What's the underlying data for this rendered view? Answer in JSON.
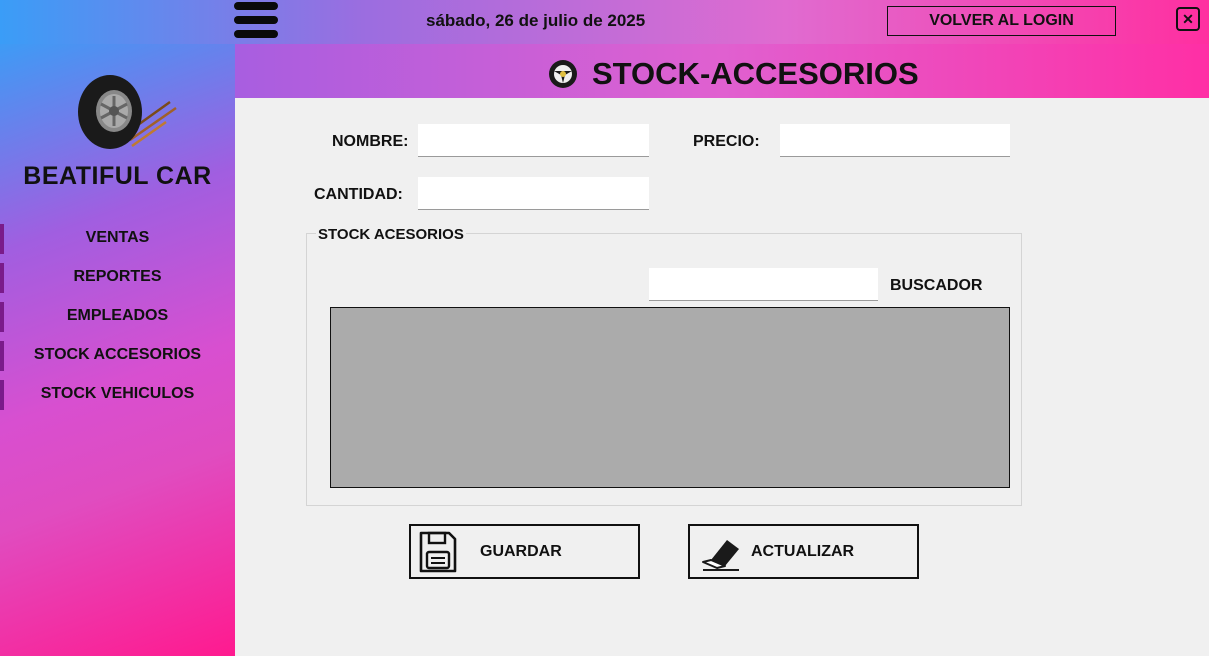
{
  "topbar": {
    "date": "sábado, 26 de julio de 2025",
    "login_button": "VOLVER AL LOGIN",
    "close_icon": "close-icon"
  },
  "sidebar": {
    "brand": "BEATIFUL CAR",
    "logo_icon": "tire-icon",
    "items": [
      {
        "label": "VENTAS"
      },
      {
        "label": "REPORTES"
      },
      {
        "label": "EMPLEADOS"
      },
      {
        "label": "STOCK ACCESORIOS"
      },
      {
        "label": "STOCK VEHICULOS"
      }
    ]
  },
  "header": {
    "title": "STOCK-ACCESORIOS",
    "icon": "steering-wheel-icon"
  },
  "form": {
    "nombre_label": "NOMBRE:",
    "nombre_value": "",
    "precio_label": "PRECIO:",
    "precio_value": "",
    "cantidad_label": "CANTIDAD:",
    "cantidad_value": ""
  },
  "stock_group": {
    "legend": "STOCK ACESORIOS",
    "search_label": "BUSCADOR",
    "search_value": ""
  },
  "actions": {
    "save_label": "GUARDAR",
    "save_icon": "floppy-disk-icon",
    "update_label": "ACTUALIZAR",
    "update_icon": "eraser-icon"
  },
  "colors": {
    "accent_blue": "#3a9df7",
    "accent_purple": "#9b6de0",
    "accent_pink": "#ff2fa0",
    "grid_bg": "#ababab"
  }
}
